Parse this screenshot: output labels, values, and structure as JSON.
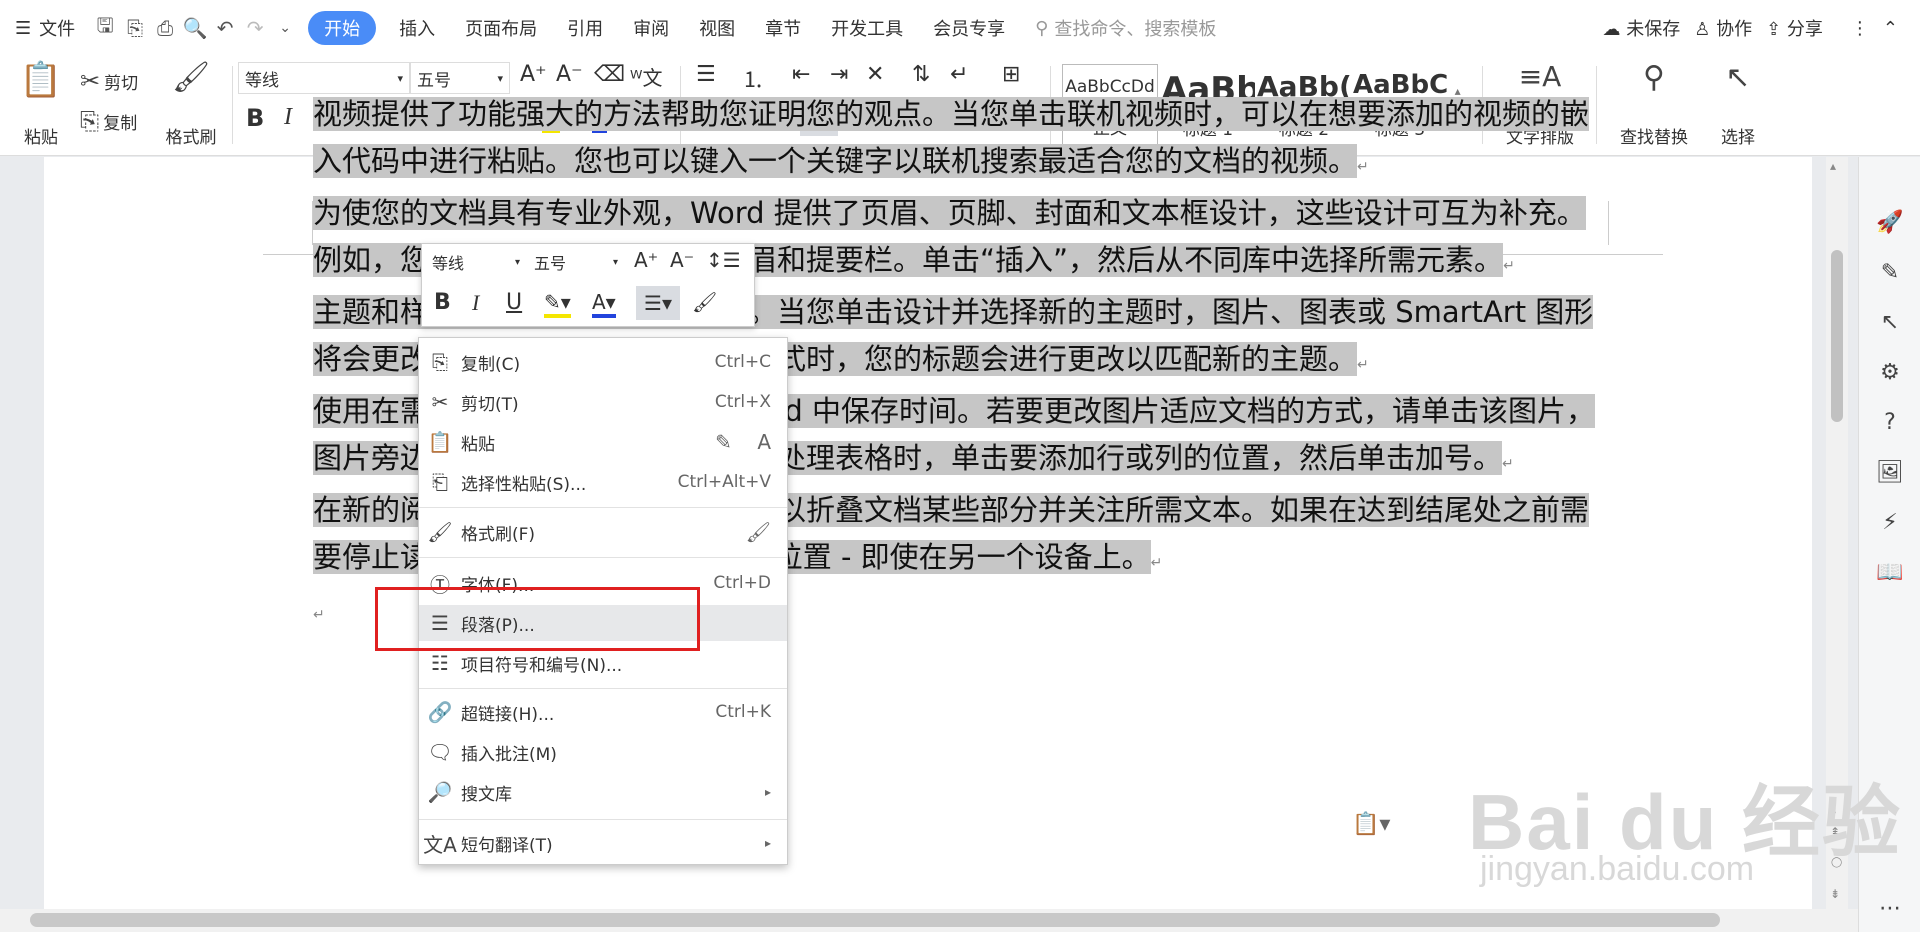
{
  "menubar": {
    "file": "文件",
    "tabs": [
      "开始",
      "插入",
      "页面布局",
      "引用",
      "审阅",
      "视图",
      "章节",
      "开发工具",
      "会员专享"
    ],
    "search_placeholder": "查找命令、搜索模板",
    "unsaved": "未保存",
    "collab": "协作",
    "share": "分享"
  },
  "ribbon": {
    "paste": "粘贴",
    "cut": "剪切",
    "copy": "复制",
    "format_painter": "格式刷",
    "font_name": "等线",
    "font_size": "五号",
    "styles": [
      {
        "preview": "AaBbCcDd",
        "label": "正文"
      },
      {
        "preview": "AaBb",
        "label": "标题 1"
      },
      {
        "preview": "AaBb(",
        "label": "标题 2"
      },
      {
        "preview": "AaBbC",
        "label": "标题 3"
      }
    ],
    "text_layout": "文字排版",
    "find_replace": "查找替换",
    "select": "选择"
  },
  "document": {
    "paragraphs": [
      "视频提供了功能强大的方法帮助您证明您的观点。当您单击联机视频时，可以在想要添加的视频的嵌入代码中进行粘贴。您也可以键入一个关键字以联机搜索最适合您的文档的视频。",
      "为使您的文档具有专业外观，Word 提供了页眉、页脚、封面和文本框设计，这些设计可互为补充。例如，您可以添加匹配的封面、页眉和提要栏。单击“插入”，然后从不同库中选择所需元素。",
      "主题和样式也有助于文档保持协调。当您单击设计并选择新的主题时，图片、图表或 SmartArt 图形将会更改以匹配新的主题。当应用样式时，您的标题会进行更改以匹配新的主题。",
      "使用在需要位置出现的新按钮在 Word 中保存时间。若要更改图片适应文档的方式，请单击该图片，图片旁边将会显示布局选项按钮。当处理表格时，单击要添加行或列的位置，然后单击加号。",
      "在新的阅读视图中阅读更加容易。可以折叠文档某些部分并关注所需文本。如果在达到结尾处之前需要停止读取，Word 会记住您的停止位置 - 即使在另一个设备上。"
    ]
  },
  "mini_toolbar": {
    "font_name": "等线",
    "font_size": "五号"
  },
  "context_menu": {
    "items": [
      {
        "label": "复制(C)",
        "shortcut": "Ctrl+C",
        "icon": "copy-icon"
      },
      {
        "label": "剪切(T)",
        "shortcut": "Ctrl+X",
        "icon": "scissors-icon"
      },
      {
        "label": "粘贴",
        "shortcut": "",
        "icon": "paste-icon"
      },
      {
        "label": "选择性粘贴(S)...",
        "shortcut": "Ctrl+Alt+V",
        "icon": "paste-special-icon"
      },
      {
        "label": "格式刷(F)",
        "shortcut": "",
        "icon": "format-painter-icon"
      },
      {
        "label": "字体(F)...",
        "shortcut": "Ctrl+D",
        "icon": "font-icon"
      },
      {
        "label": "段落(P)...",
        "shortcut": "",
        "icon": "paragraph-icon"
      },
      {
        "label": "项目符号和编号(N)...",
        "shortcut": "",
        "icon": "bullets-icon"
      },
      {
        "label": "超链接(H)...",
        "shortcut": "Ctrl+K",
        "icon": "link-icon"
      },
      {
        "label": "插入批注(M)",
        "shortcut": "",
        "icon": "comment-icon"
      },
      {
        "label": "搜文库",
        "shortcut": "",
        "icon": "library-icon"
      },
      {
        "label": "短句翻译(T)",
        "shortcut": "",
        "icon": "translate-icon"
      }
    ]
  },
  "watermark": {
    "brand": "Bai du 经验",
    "url": "jingyan.baidu.com"
  }
}
